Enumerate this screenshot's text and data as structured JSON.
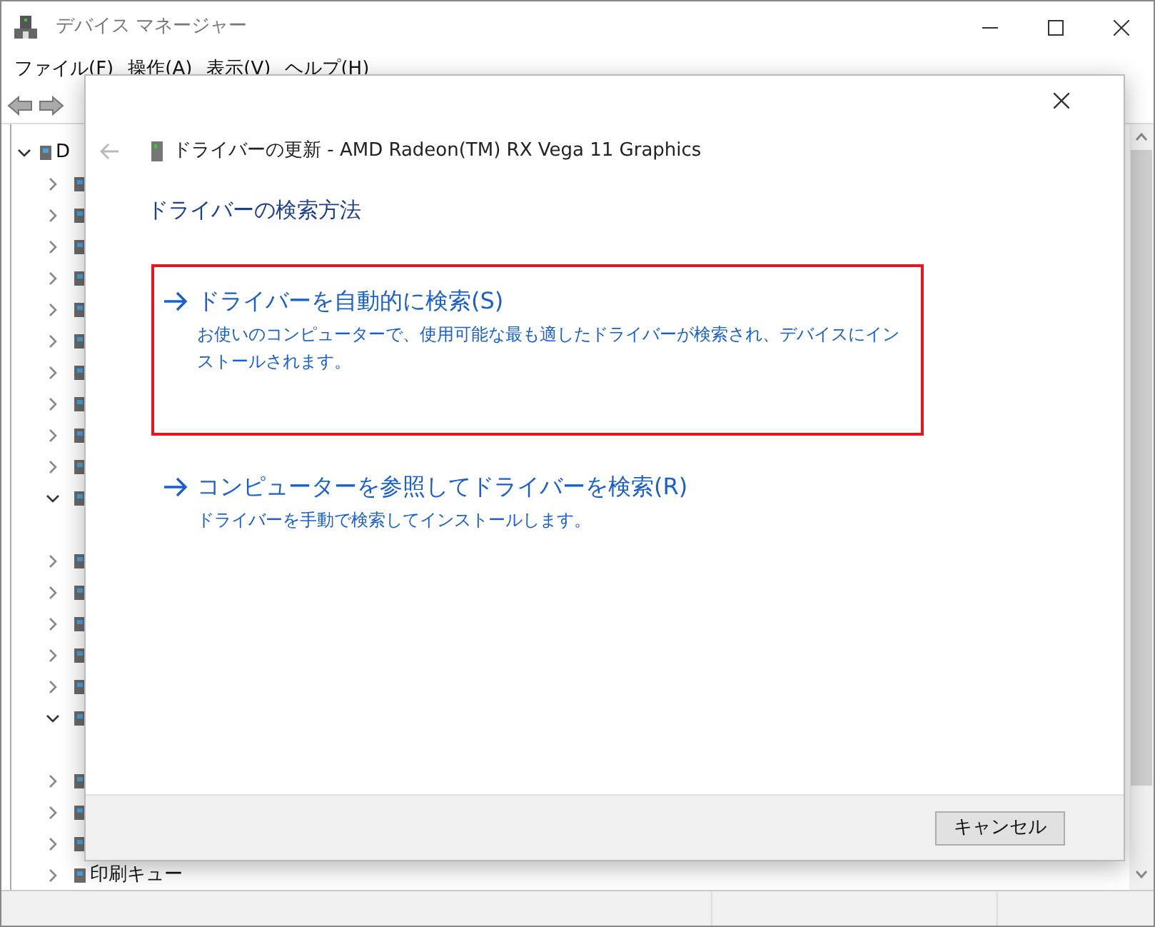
{
  "window": {
    "title": "デバイス マネージャー"
  },
  "menu": [
    "ファイル(F)",
    "操作(A)",
    "表示(V)",
    "ヘルプ(H)"
  ],
  "tree": [
    {
      "label": "D",
      "expanded": true
    },
    {
      "expanded": false
    },
    {
      "expanded": false
    },
    {
      "expanded": false
    },
    {
      "expanded": false
    },
    {
      "expanded": false
    },
    {
      "expanded": false
    },
    {
      "expanded": false
    },
    {
      "expanded": false
    },
    {
      "expanded": false
    },
    {
      "expanded": false
    },
    {
      "expanded": true
    },
    {
      "expanded": false
    },
    {
      "expanded": false
    },
    {
      "expanded": false
    },
    {
      "expanded": false
    },
    {
      "expanded": false
    },
    {
      "expanded": true
    },
    {
      "expanded": false
    },
    {
      "expanded": false
    },
    {
      "expanded": false
    },
    {
      "label": "印刷キュー",
      "expanded": false
    }
  ],
  "dialog": {
    "title": "ドライバーの更新 - AMD Radeon(TM) RX Vega 11 Graphics",
    "heading": "ドライバーの検索方法",
    "options": [
      {
        "title": "ドライバーを自動的に検索(S)",
        "description": "お使いのコンピューターで、使用可能な最も適したドライバーが検索され、デバイスにインストールされます。",
        "highlighted": true
      },
      {
        "title": "コンピューターを参照してドライバーを検索(R)",
        "description": "ドライバーを手動で検索してインストールします。",
        "highlighted": false
      }
    ],
    "cancel_button": "キャンセル"
  }
}
